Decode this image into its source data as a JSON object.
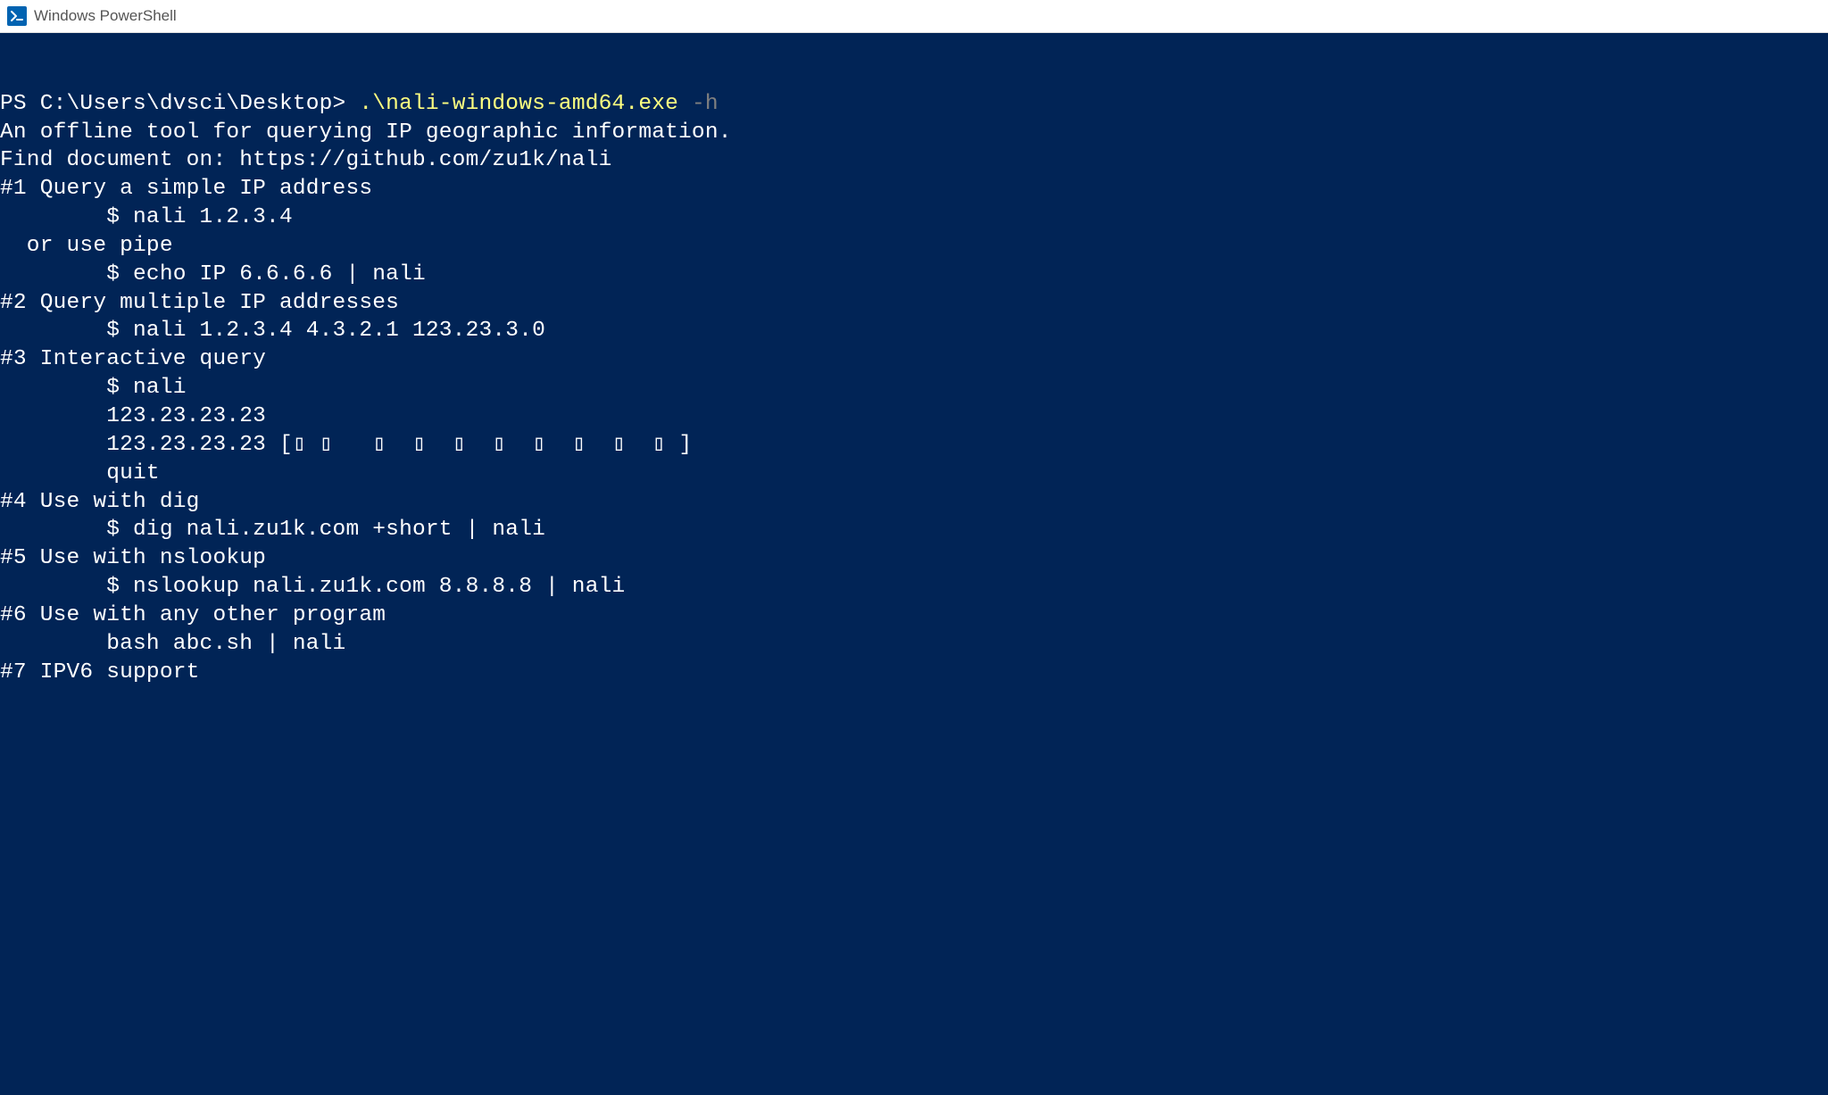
{
  "titlebar": {
    "title": "Windows PowerShell"
  },
  "terminal": {
    "prompt": "PS C:\\Users\\dvsci\\Desktop> ",
    "command": ".\\nali-windows-amd64.exe",
    "flag": " -h",
    "lines": {
      "desc": "An offline tool for querying IP geographic information.",
      "blank1": "",
      "doc": "Find document on: https://github.com/zu1k/nali",
      "blank2": "",
      "h1": "#1 Query a simple IP address",
      "blank3": "",
      "ex1": "        $ nali 1.2.3.4",
      "blank4": "",
      "pipe": "  or use pipe",
      "blank5": "",
      "ex2": "        $ echo IP 6.6.6.6 | nali",
      "blank6": "",
      "h2": "#2 Query multiple IP addresses",
      "blank7": "",
      "ex3": "        $ nali 1.2.3.4 4.3.2.1 123.23.3.0",
      "blank8": "",
      "h3": "#3 Interactive query",
      "blank9": "",
      "ex4a": "        $ nali",
      "ex4b": "        123.23.23.23",
      "ex4c": "        123.23.23.23 [▯ ▯   ▯  ▯  ▯  ▯  ▯  ▯  ▯  ▯ ]",
      "ex4d": "        quit",
      "blank10": "",
      "h4": "#4 Use with dig",
      "blank11": "",
      "ex5": "        $ dig nali.zu1k.com +short | nali",
      "blank12": "",
      "h5": "#5 Use with nslookup",
      "blank13": "",
      "ex6": "        $ nslookup nali.zu1k.com 8.8.8.8 | nali",
      "blank14": "",
      "h6": "#6 Use with any other program",
      "blank15": "",
      "ex7": "        bash abc.sh | nali",
      "blank16": "",
      "h7": "#7 IPV6 support"
    }
  }
}
